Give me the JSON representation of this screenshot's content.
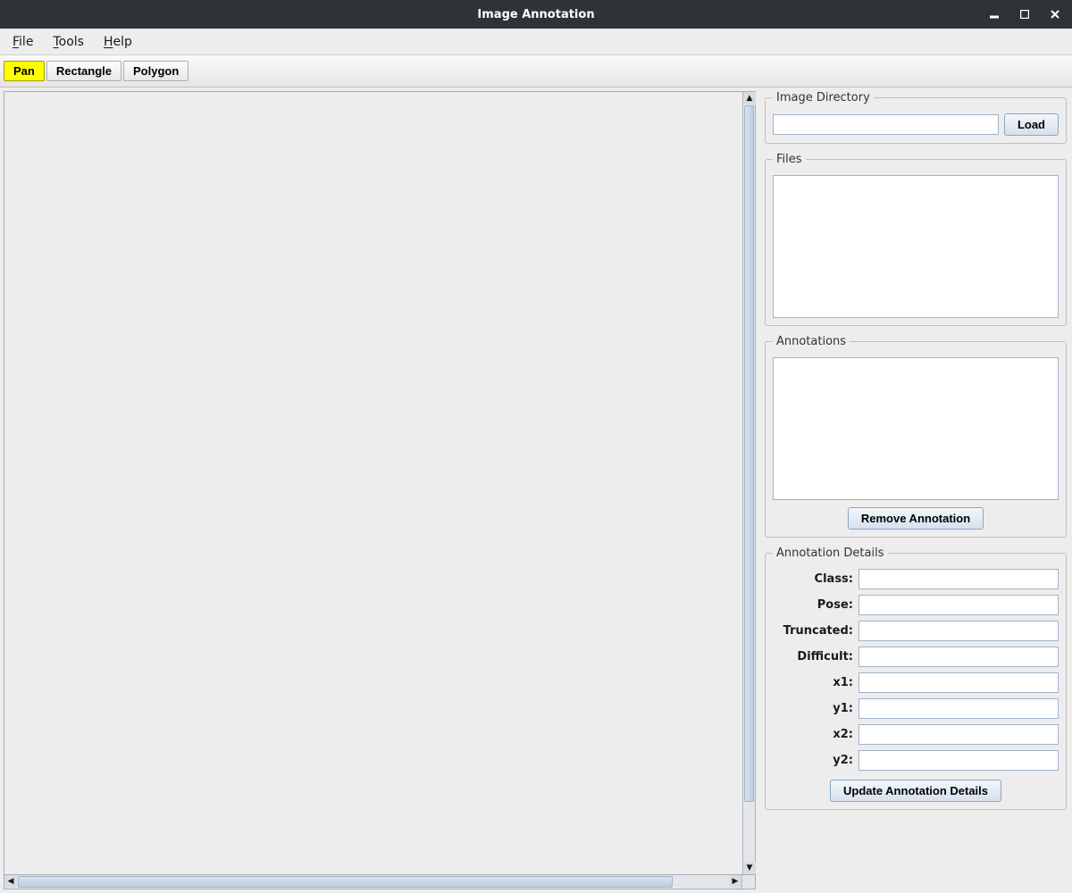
{
  "window": {
    "title": "Image Annotation"
  },
  "menubar": {
    "file": "File",
    "tools": "Tools",
    "help": "Help"
  },
  "toolbar": {
    "pan": "Pan",
    "rectangle": "Rectangle",
    "polygon": "Polygon",
    "active": "pan"
  },
  "sidepanel": {
    "image_directory": {
      "legend": "Image Directory",
      "path": "",
      "load_button": "Load"
    },
    "files": {
      "legend": "Files"
    },
    "annotations": {
      "legend": "Annotations",
      "remove_button": "Remove Annotation"
    },
    "details": {
      "legend": "Annotation Details",
      "labels": {
        "class": "Class:",
        "pose": "Pose:",
        "truncated": "Truncated:",
        "difficult": "Difficult:",
        "x1": "x1:",
        "y1": "y1:",
        "x2": "x2:",
        "y2": "y2:"
      },
      "values": {
        "class": "",
        "pose": "",
        "truncated": "",
        "difficult": "",
        "x1": "",
        "y1": "",
        "x2": "",
        "y2": ""
      },
      "update_button": "Update Annotation Details"
    }
  }
}
